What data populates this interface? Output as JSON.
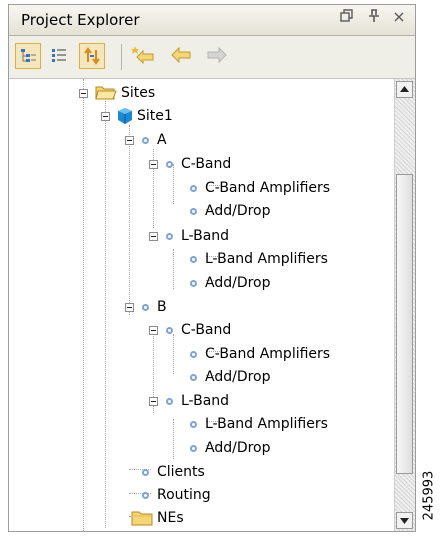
{
  "panel": {
    "title": "Project Explorer",
    "controls": [
      "restore-icon",
      "pin-icon",
      "close-icon"
    ]
  },
  "toolbar": {
    "tools": [
      "tree-view-icon",
      "list-view-icon",
      "sync-icon",
      "favorite-back-icon",
      "back-arrow-icon",
      "forward-arrow-icon"
    ]
  },
  "tree": {
    "sites": "Sites",
    "site1": "Site1",
    "a": "A",
    "a_cband": "C-Band",
    "a_cband_amp": "C-Band Amplifiers",
    "a_cband_adddrop": "Add/Drop",
    "a_lband": "L-Band",
    "a_lband_amp": "L-Band Amplifiers",
    "a_lband_adddrop": "Add/Drop",
    "b": "B",
    "b_cband": "C-Band",
    "b_cband_amp": "C-Band Amplifiers",
    "b_cband_adddrop": "Add/Drop",
    "b_lband": "L-Band",
    "b_lband_amp": "L-Band Amplifiers",
    "b_lband_adddrop": "Add/Drop",
    "clients": "Clients",
    "routing": "Routing",
    "nes": "NEs"
  },
  "figure_number": "245993",
  "colors": {
    "bullet": "#7fa3d6",
    "folder": "#f4d677",
    "cube": "#1e88d0",
    "toggle_pressed": "#f6e6bc"
  }
}
